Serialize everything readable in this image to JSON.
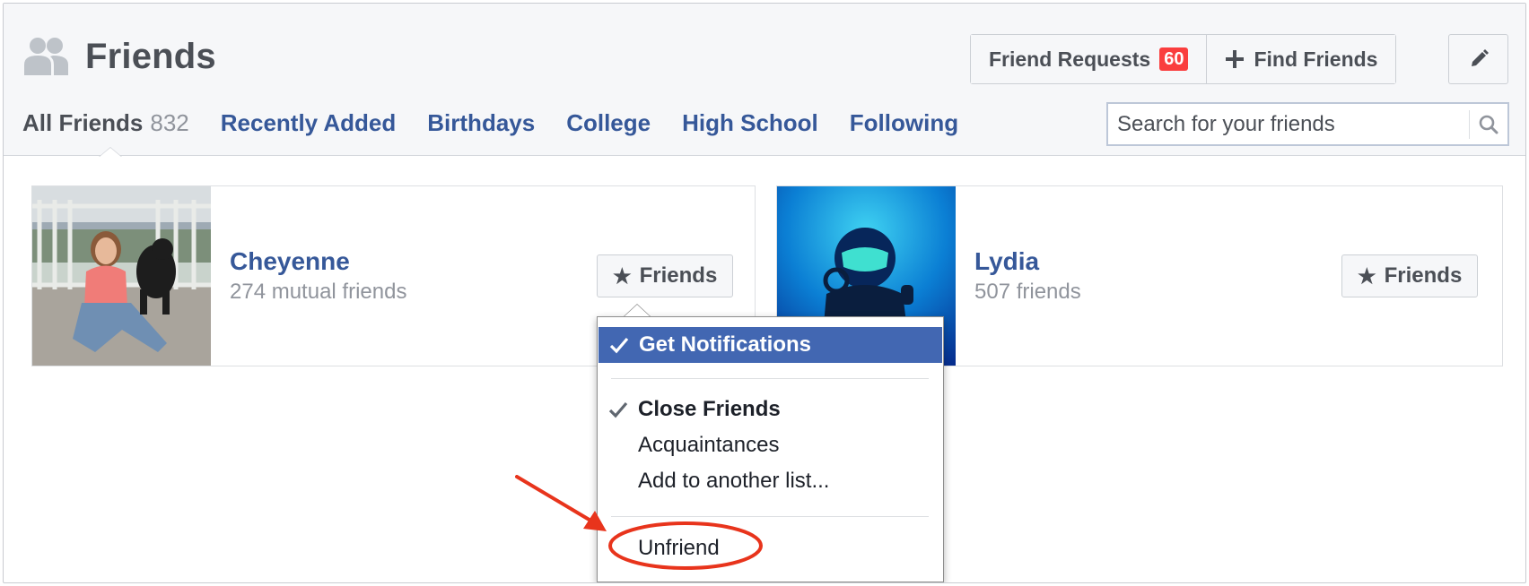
{
  "header": {
    "title": "Friends",
    "friend_requests_label": "Friend Requests",
    "friend_requests_count": "60",
    "find_friends_label": "Find Friends",
    "icons": [
      "friends-icon",
      "plus-icon",
      "pencil-icon",
      "search-icon"
    ]
  },
  "tabs": [
    {
      "label": "All Friends",
      "count": "832",
      "active": true
    },
    {
      "label": "Recently Added"
    },
    {
      "label": "Birthdays"
    },
    {
      "label": "College"
    },
    {
      "label": "High School"
    },
    {
      "label": "Following"
    }
  ],
  "search": {
    "placeholder": "Search for your friends",
    "value": ""
  },
  "friends": [
    {
      "name": "Cheyenne",
      "subtitle": "274 mutual friends",
      "button_label": "Friends"
    },
    {
      "name": "Lydia",
      "subtitle": "507 friends",
      "button_label": "Friends"
    }
  ],
  "dropdown": {
    "items": [
      {
        "label": "Get Notifications",
        "checked": true,
        "highlighted": true
      },
      {
        "label": "Close Friends",
        "checked": true,
        "bold": true
      },
      {
        "label": "Acquaintances",
        "checked": false
      },
      {
        "label": "Add to another list...",
        "checked": false
      },
      {
        "label": "Unfriend",
        "checked": false,
        "annotated": true
      }
    ]
  },
  "colors": {
    "link_blue": "#365899",
    "highlight_blue": "#4267b2",
    "badge_red": "#fa3e3e",
    "annotation_red": "#e8341c",
    "header_bg": "#f6f7f9"
  }
}
